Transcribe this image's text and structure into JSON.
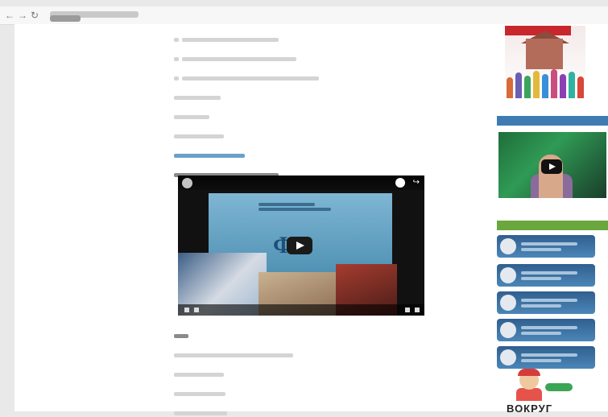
{
  "browser": {
    "back_glyph": "←",
    "forward_glyph": "→",
    "reload_glyph": "↻"
  },
  "main": {
    "lines": [
      {
        "text": "",
        "style": "plain"
      },
      {
        "text": "",
        "style": "plain"
      },
      {
        "text": "",
        "style": "plain"
      },
      {
        "text": "",
        "style": "plain"
      },
      {
        "text": "",
        "style": "plain"
      },
      {
        "text": "",
        "style": "plain"
      },
      {
        "text": "",
        "style": "link"
      },
      {
        "text": "",
        "style": "dark"
      }
    ],
    "after_video": [
      {
        "text": "",
        "style": "plain"
      },
      {
        "text": "",
        "style": "plain"
      },
      {
        "text": "",
        "style": "plain"
      },
      {
        "text": "",
        "style": "plain"
      },
      {
        "text": "",
        "style": "plain"
      }
    ]
  },
  "video": {
    "title": "",
    "logo": "ФК",
    "share_glyph": "↪"
  },
  "sidebar": {
    "section_video": "",
    "section_partners": "",
    "video_title": "",
    "partners": [
      "",
      "",
      "",
      "",
      ""
    ],
    "vokrug": "ВОКРУГ"
  },
  "colors": {
    "section_blue": "#3e7bb3",
    "section_green": "#6aa73d"
  }
}
